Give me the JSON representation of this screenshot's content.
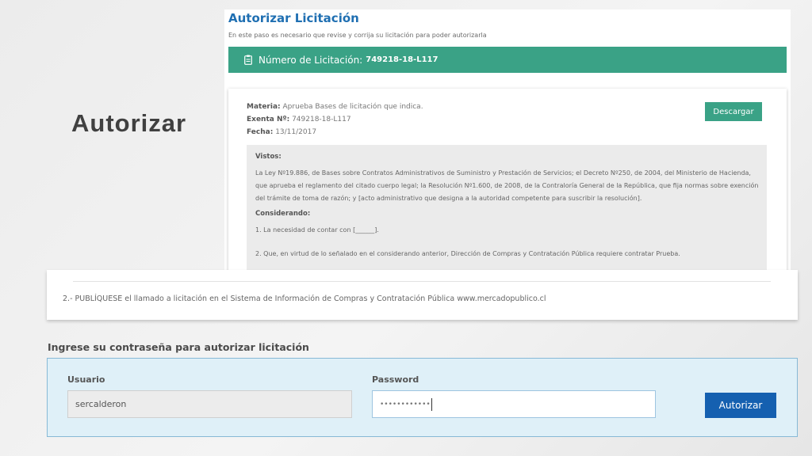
{
  "slide": {
    "title": "Autorizar"
  },
  "page": {
    "title": "Autorizar Licitación",
    "subtitle": "En este paso es necesario que revise y corrija su licitación para poder autorizarla"
  },
  "licitacion": {
    "label": "Número de Licitación:",
    "number": "749218-18-L117",
    "icon": "clipboard-icon"
  },
  "document": {
    "materia_label": "Materia:",
    "materia": "Aprueba Bases de licitación que indica.",
    "exenta_label": "Exenta Nº:",
    "exenta": "749218-18-L117",
    "fecha_label": "Fecha:",
    "fecha": "13/11/2017",
    "download_label": "Descargar",
    "vistos_heading": "Vistos:",
    "vistos_text": "La Ley Nº19.886, de Bases sobre Contratos Administrativos de Suministro y Prestación de Servicios; el Decreto Nº250, de 2004, del Ministerio de Hacienda, que aprueba el reglamento del citado cuerpo legal; la Resolución Nº1.600, de 2008, de la Contraloría General de la República, que fija normas sobre exención del trámite de toma de razón; y [acto administrativo que designa a la autoridad competente para suscribir la resolución].",
    "considerando_heading": "Considerando:",
    "considerando_1": "1. La necesidad de contar con [______].",
    "considerando_2": "2. Que, en virtud de lo señalado en el considerando anterior, Dirección de Compras y Contratación Pública requiere contratar Prueba.",
    "publiquese": "2.- PUBLÍQUESE el llamado a licitación en el Sistema de Información de Compras y Contratación Pública www.mercadopublico.cl"
  },
  "login": {
    "heading": "Ingrese su contraseña para autorizar licitación",
    "usuario_label": "Usuario",
    "usuario_value": "sercalderon",
    "password_label": "Password",
    "password_value": "••••••••••••",
    "submit_label": "Autorizar"
  },
  "colors": {
    "green": "#3aa286",
    "blue": "#1560b0",
    "title_blue": "#1f6fb2",
    "panel_bg": "#dff0f8"
  }
}
